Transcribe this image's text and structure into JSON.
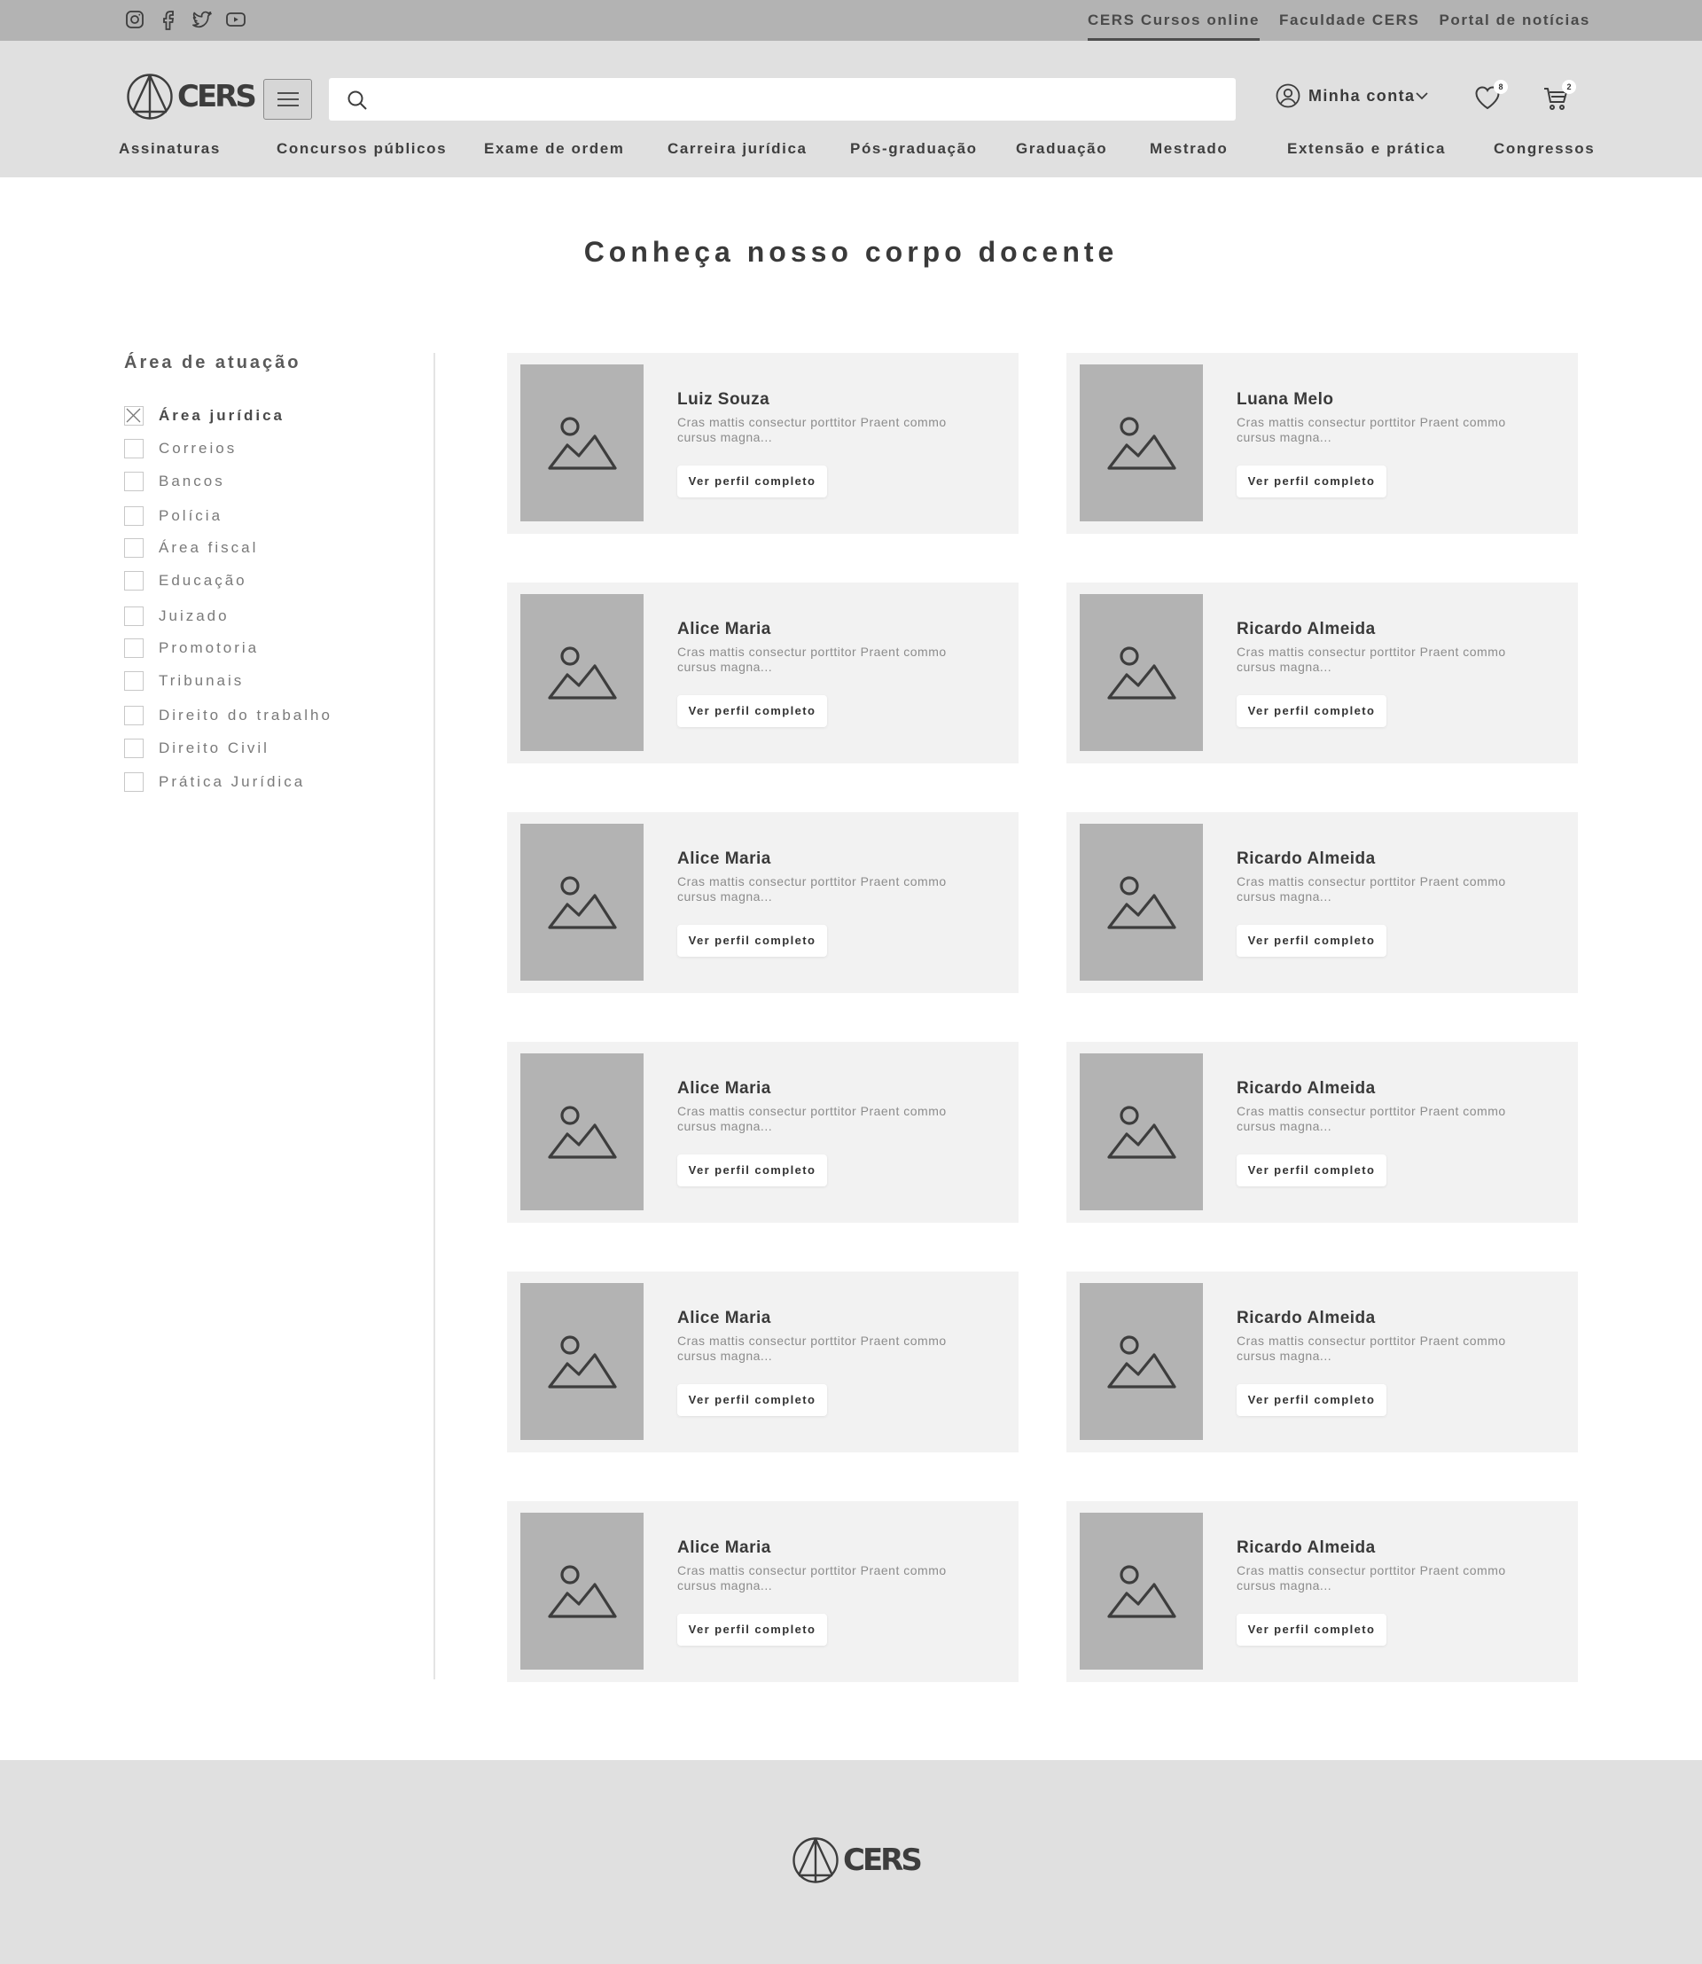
{
  "topbar": {
    "social": [
      "instagram-icon",
      "facebook-icon",
      "twitter-icon",
      "youtube-icon"
    ],
    "links": [
      "CERS Cursos online",
      "Faculdade CERS",
      "Portal de notícias"
    ]
  },
  "header": {
    "logo_text": "CERS",
    "search_value": "",
    "account_label": "Minha conta",
    "wishlist_count": "8",
    "cart_count": "2"
  },
  "nav": [
    "Assinaturas",
    "Concursos públicos",
    "Exame de ordem",
    "Carreira jurídica",
    "Pós-graduação",
    "Graduação",
    "Mestrado",
    "Extensão e prática",
    "Congressos"
  ],
  "page": {
    "title": "Conheça nosso corpo docente"
  },
  "sidebar": {
    "title": "Área de atuação",
    "filters": [
      {
        "label": "Área jurídica",
        "checked": true
      },
      {
        "label": "Correios",
        "checked": false
      },
      {
        "label": "Bancos",
        "checked": false
      },
      {
        "label": "Polícia",
        "checked": false
      },
      {
        "label": "Área fiscal",
        "checked": false
      },
      {
        "label": "Educação",
        "checked": false
      },
      {
        "label": "Juizado",
        "checked": false
      },
      {
        "label": "Promotoria",
        "checked": false
      },
      {
        "label": "Tribunais",
        "checked": false
      },
      {
        "label": "Direito do trabalho",
        "checked": false
      },
      {
        "label": "Direito Civil",
        "checked": false
      },
      {
        "label": "Prática Jurídica",
        "checked": false
      }
    ]
  },
  "teachers": [
    {
      "name": "Luiz Souza",
      "desc": "Cras mattis consectur porttitor Praent commo cursus magna...",
      "button": "Ver perfil completo"
    },
    {
      "name": "Luana Melo",
      "desc": "Cras mattis consectur porttitor Praent commo cursus magna...",
      "button": "Ver perfil completo"
    },
    {
      "name": "Alice Maria",
      "desc": "Cras mattis consectur porttitor Praent commo cursus magna...",
      "button": "Ver perfil completo"
    },
    {
      "name": "Ricardo Almeida",
      "desc": "Cras mattis consectur porttitor Praent commo cursus magna...",
      "button": "Ver perfil completo"
    },
    {
      "name": "Alice Maria",
      "desc": "Cras mattis consectur porttitor Praent commo cursus magna...",
      "button": "Ver perfil completo"
    },
    {
      "name": "Ricardo Almeida",
      "desc": "Cras mattis consectur porttitor Praent commo cursus magna...",
      "button": "Ver perfil completo"
    },
    {
      "name": "Alice Maria",
      "desc": "Cras mattis consectur porttitor Praent commo cursus magna...",
      "button": "Ver perfil completo"
    },
    {
      "name": "Ricardo Almeida",
      "desc": "Cras mattis consectur porttitor Praent commo cursus magna...",
      "button": "Ver perfil completo"
    },
    {
      "name": "Alice Maria",
      "desc": "Cras mattis consectur porttitor Praent commo cursus magna...",
      "button": "Ver perfil completo"
    },
    {
      "name": "Ricardo Almeida",
      "desc": "Cras mattis consectur porttitor Praent commo cursus magna...",
      "button": "Ver perfil completo"
    },
    {
      "name": "Alice Maria",
      "desc": "Cras mattis consectur porttitor Praent commo cursus magna...",
      "button": "Ver perfil completo"
    },
    {
      "name": "Ricardo Almeida",
      "desc": "Cras mattis consectur porttitor Praent commo cursus magna...",
      "button": "Ver perfil completo"
    }
  ],
  "footer": {
    "logo_text": "CERS"
  },
  "colors": {
    "topbar": "#b3b3b3",
    "header": "#e0e0e0",
    "card": "#f2f2f2",
    "placeholder": "#b3b3b3",
    "text": "#3a3a3a"
  }
}
